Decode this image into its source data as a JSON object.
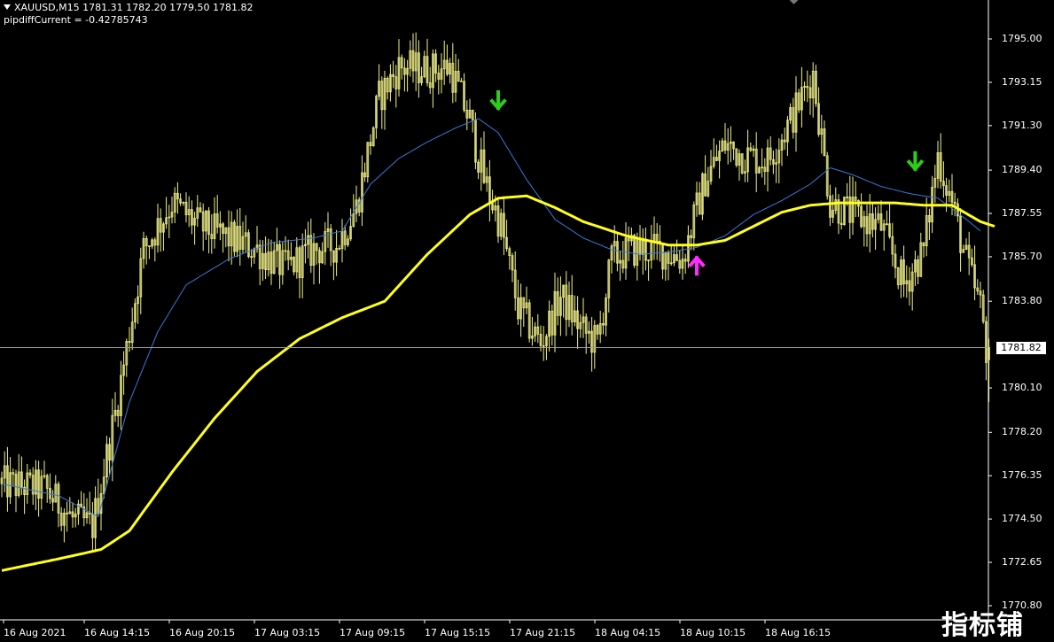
{
  "header": {
    "symbol_line": "XAUUSD,M15  1781.31 1782.20 1779.50 1781.82",
    "indicator_line": "pipdiffCurrent = -0.42785743"
  },
  "current_price_label": "1781.82",
  "watermark": "指标铺",
  "colors": {
    "background": "#000000",
    "candles": "#f2f28a",
    "fast_ma": "#3a78d8",
    "slow_ma": "#ffff1a",
    "sell_arrow": "#2ecc1a",
    "buy_arrow": "#ff2bff",
    "price_line": "#9a9a9a",
    "axis_text": "#ffffff"
  },
  "chart_data": {
    "type": "line",
    "instrument": "XAUUSD",
    "timeframe": "M15",
    "last_bar": {
      "open": 1781.31,
      "high": 1782.2,
      "low": 1779.5,
      "close": 1781.82
    },
    "ylim": [
      1770.8,
      1795.9
    ],
    "y_ticks": [
      "1795.00",
      "1793.15",
      "1791.30",
      "1789.40",
      "1787.55",
      "1785.70",
      "1783.80",
      "1781.82",
      "1780.10",
      "1778.20",
      "1776.35",
      "1774.50",
      "1772.65",
      "1770.80"
    ],
    "x_ticks": [
      "16 Aug 2021",
      "16 Aug 14:15",
      "16 Aug 20:15",
      "17 Aug 03:15",
      "17 Aug 09:15",
      "17 Aug 15:15",
      "17 Aug 21:15",
      "18 Aug 04:15",
      "18 Aug 10:15",
      "18 Aug 16:15"
    ],
    "series": [
      {
        "kind": "price",
        "anchors": [
          [
            0,
            1776.0
          ],
          [
            15,
            1775.8
          ],
          [
            25,
            1774.5
          ],
          [
            32,
            1774.2
          ],
          [
            40,
            1779.0
          ],
          [
            50,
            1786.0
          ],
          [
            60,
            1788.0
          ],
          [
            70,
            1787.0
          ],
          [
            80,
            1786.5
          ],
          [
            90,
            1786.0
          ],
          [
            100,
            1785.2
          ],
          [
            110,
            1786.0
          ],
          [
            118,
            1786.2
          ],
          [
            125,
            1787.8
          ],
          [
            133,
            1792.5
          ],
          [
            140,
            1793.8
          ],
          [
            150,
            1793.7
          ],
          [
            158,
            1793.8
          ],
          [
            165,
            1791.5
          ],
          [
            170,
            1789.0
          ],
          [
            176,
            1787.0
          ],
          [
            182,
            1783.5
          ],
          [
            190,
            1782.0
          ],
          [
            197,
            1784.0
          ],
          [
            205,
            1782.5
          ],
          [
            210,
            1782.0
          ],
          [
            215,
            1785.6
          ],
          [
            222,
            1786.0
          ],
          [
            232,
            1786.0
          ],
          [
            240,
            1785.6
          ],
          [
            248,
            1789.0
          ],
          [
            255,
            1790.5
          ],
          [
            262,
            1790.0
          ],
          [
            270,
            1789.8
          ],
          [
            278,
            1791.5
          ],
          [
            286,
            1793.5
          ],
          [
            292,
            1788.0
          ],
          [
            300,
            1787.5
          ],
          [
            310,
            1787.0
          ],
          [
            318,
            1784.5
          ],
          [
            325,
            1786.0
          ],
          [
            330,
            1790.0
          ],
          [
            335,
            1788.0
          ],
          [
            340,
            1785.5
          ],
          [
            345,
            1783.5
          ],
          [
            348,
            1781.0
          ]
        ]
      },
      {
        "kind": "fast_ma",
        "anchors": [
          [
            0,
            1776.0
          ],
          [
            20,
            1775.5
          ],
          [
            34,
            1774.6
          ],
          [
            45,
            1779.5
          ],
          [
            55,
            1782.5
          ],
          [
            65,
            1784.5
          ],
          [
            80,
            1785.6
          ],
          [
            95,
            1786.3
          ],
          [
            110,
            1786.5
          ],
          [
            120,
            1786.8
          ],
          [
            130,
            1788.8
          ],
          [
            140,
            1789.9
          ],
          [
            150,
            1790.6
          ],
          [
            160,
            1791.2
          ],
          [
            168,
            1791.6
          ],
          [
            175,
            1791.0
          ],
          [
            185,
            1789.0
          ],
          [
            195,
            1787.3
          ],
          [
            205,
            1786.5
          ],
          [
            215,
            1786.0
          ],
          [
            225,
            1785.8
          ],
          [
            235,
            1785.9
          ],
          [
            245,
            1786.1
          ],
          [
            255,
            1786.6
          ],
          [
            265,
            1787.5
          ],
          [
            275,
            1788.1
          ],
          [
            285,
            1788.8
          ],
          [
            292,
            1789.5
          ],
          [
            300,
            1789.2
          ],
          [
            310,
            1788.7
          ],
          [
            320,
            1788.4
          ],
          [
            330,
            1788.2
          ],
          [
            340,
            1787.3
          ],
          [
            345,
            1786.8
          ]
        ]
      },
      {
        "kind": "slow_ma",
        "anchors": [
          [
            0,
            1772.3
          ],
          [
            20,
            1772.8
          ],
          [
            35,
            1773.2
          ],
          [
            45,
            1774.0
          ],
          [
            60,
            1776.5
          ],
          [
            75,
            1778.8
          ],
          [
            90,
            1780.8
          ],
          [
            105,
            1782.2
          ],
          [
            120,
            1783.1
          ],
          [
            135,
            1783.8
          ],
          [
            150,
            1785.8
          ],
          [
            165,
            1787.5
          ],
          [
            175,
            1788.2
          ],
          [
            185,
            1788.3
          ],
          [
            195,
            1787.8
          ],
          [
            205,
            1787.2
          ],
          [
            220,
            1786.6
          ],
          [
            235,
            1786.2
          ],
          [
            245,
            1786.2
          ],
          [
            255,
            1786.4
          ],
          [
            265,
            1787.0
          ],
          [
            275,
            1787.6
          ],
          [
            285,
            1787.9
          ],
          [
            295,
            1788.0
          ],
          [
            305,
            1788.0
          ],
          [
            315,
            1788.0
          ],
          [
            325,
            1787.9
          ],
          [
            335,
            1787.9
          ],
          [
            345,
            1787.2
          ],
          [
            350,
            1787.0
          ]
        ]
      }
    ],
    "signals": [
      {
        "type": "sell",
        "bar": 175,
        "price": 1792.2
      },
      {
        "type": "buy",
        "bar": 245,
        "price": 1785.5
      },
      {
        "type": "sell",
        "bar": 322,
        "price": 1789.6
      }
    ],
    "current_price": 1781.82
  }
}
